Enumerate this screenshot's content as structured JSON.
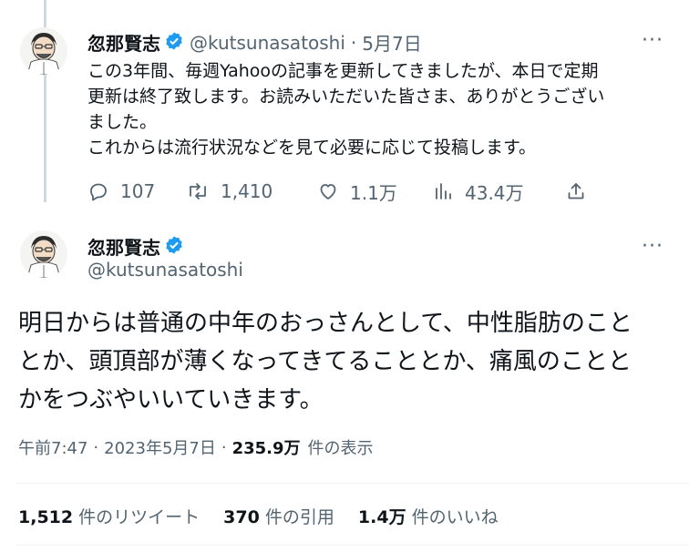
{
  "first_tweet": {
    "author_name": "忽那賢志",
    "handle": "@kutsunasatoshi",
    "separator": "·",
    "date": "5月7日",
    "more": "···",
    "lines": [
      "この3年間、毎週Yahooの記事を更新してきましたが、本日で定期",
      "更新は終了致します。お読みいただいた皆さま、ありがとうござい",
      "ました。",
      "これからは流行状況などを見て必要に応じて投稿します。"
    ],
    "actions": {
      "replies": "107",
      "retweets": "1,410",
      "likes": "1.1万",
      "views": "43.4万"
    }
  },
  "main_tweet": {
    "author_name": "忽那賢志",
    "handle": "@kutsunasatoshi",
    "more": "···",
    "lines": [
      "明日からは普通の中年のおっさんとして、中性脂肪のこと",
      "とか、頭頂部が薄くなってきてることとか、痛風のことと",
      "かをつぶやいいていきます。"
    ],
    "time": "午前7:47",
    "sep1": "·",
    "date": "2023年5月7日",
    "sep2": "·",
    "view_count": "235.9万",
    "view_label": "件の表示",
    "retweet_count": "1,512",
    "retweet_label": "件のリツイート",
    "quote_count": "370",
    "quote_label": "件の引用",
    "like_count": "1.4万",
    "like_label": "件のいいね"
  },
  "colors": {
    "verified": "#1d9bf0",
    "secondary_text": "#536471",
    "primary_text": "#0f1419"
  }
}
